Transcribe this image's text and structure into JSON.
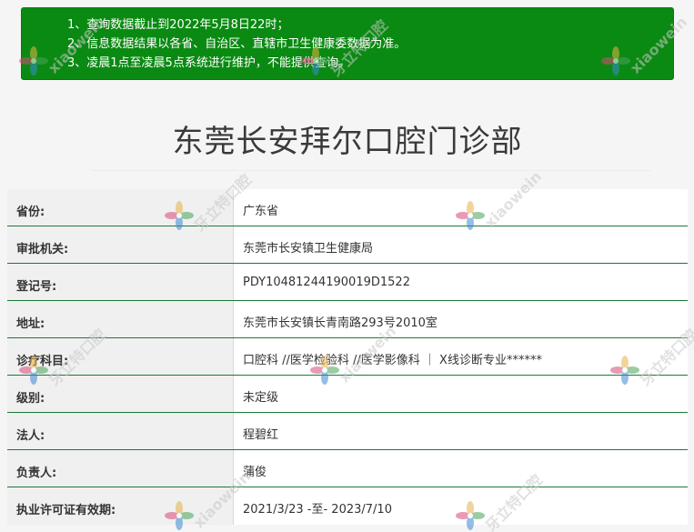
{
  "notice": {
    "lines": [
      "1、查询数据截止到2022年5月8日22时；",
      "2、信息数据结果以各省、自治区、直辖市卫生健康委数据为准。",
      "3、凌晨1点至凌晨5点系统进行维护，不能提供查询。"
    ]
  },
  "page_title": "东莞长安拜尔口腔门诊部",
  "records": [
    {
      "label": "省份:",
      "value": "广东省"
    },
    {
      "label": "审批机关:",
      "value": "东莞市长安镇卫生健康局"
    },
    {
      "label": "登记号:",
      "value": "PDY10481244190019D1522"
    },
    {
      "label": "地址:",
      "value": "东莞市长安镇长青南路293号2010室"
    },
    {
      "label": "诊疗科目:",
      "value": "口腔科 //医学检验科 //医学影像科 ｜ X线诊断专业******"
    },
    {
      "label": "级别:",
      "value": "未定级"
    },
    {
      "label": "法人:",
      "value": "程碧红"
    },
    {
      "label": "负责人:",
      "value": "蒲俊"
    },
    {
      "label": "执业许可证有效期:",
      "value": "2021/3/23 -至- 2023/7/10"
    }
  ],
  "watermark": {
    "text": "xiaowein",
    "logo_text": "牙立特口腔"
  },
  "colors": {
    "notice_bg": "#0a8a12",
    "row_rule": "#1a7a36",
    "label_bg": "#f0f0f0"
  }
}
